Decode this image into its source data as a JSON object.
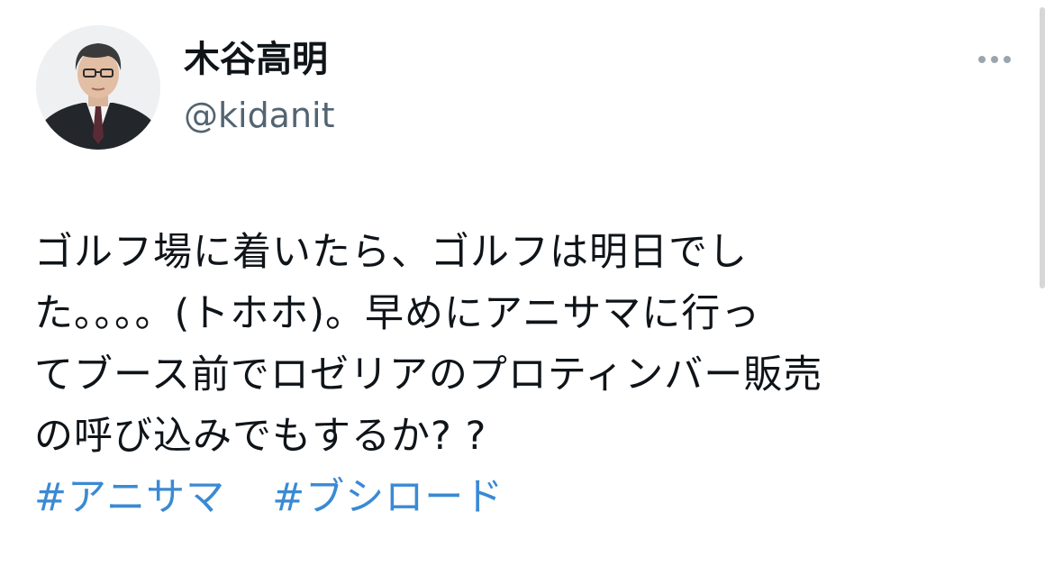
{
  "author": {
    "display_name": "木谷高明",
    "handle": "@kidanit",
    "avatar_icon": "profile-photo"
  },
  "more_icon": "ellipsis-icon",
  "tweet": {
    "lines": [
      "ゴルフ場に着いたら、ゴルフは明日でし",
      "た。。。。(トホホ)。早めにアニサマに行っ",
      "てブース前でロゼリアのプロティンバー販売",
      "の呼び込みでもするか? ?"
    ],
    "hashtags": [
      "#アニサマ",
      "#ブシロード"
    ]
  },
  "colors": {
    "text": "#0f1419",
    "handle": "#536471",
    "hashtag": "#3a8ad3",
    "icon": "#9aa5ad"
  }
}
